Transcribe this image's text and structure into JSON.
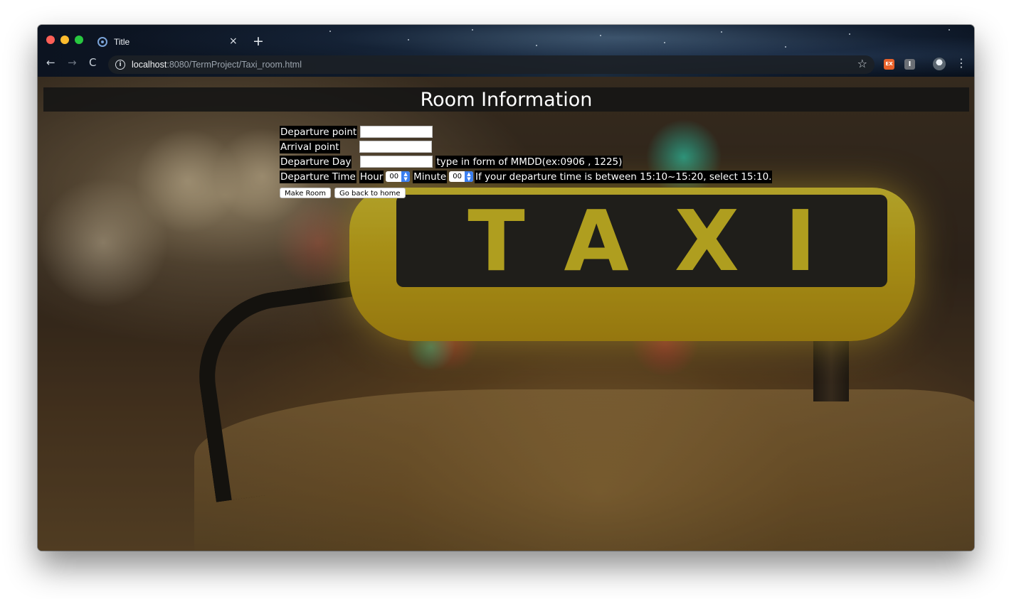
{
  "browser": {
    "tab_title": "Title",
    "url_host": "localhost",
    "url_path": ":8080/TermProject/Taxi_room.html",
    "close_glyph": "×",
    "new_tab_glyph": "+",
    "back_glyph": "←",
    "forward_glyph": "→",
    "reload_glyph": "C",
    "info_glyph": "i",
    "star_glyph": "☆",
    "menu_glyph": "⋮",
    "ext_ex_label": "EX",
    "ext_bookmark_label": "I"
  },
  "page": {
    "header_title": "Room Information",
    "taxi_sign_text": "TAXI",
    "form": {
      "departure_point_label": "Departure point",
      "departure_point_value": "",
      "arrival_point_label": "Arrival point",
      "arrival_point_value": "",
      "departure_day_label": "Departure Day",
      "departure_day_value": "",
      "departure_day_hint": "type in form of MMDD(ex:0906 , 1225)",
      "departure_time_label": "Departure Time",
      "hour_label": "Hour",
      "hour_value": "00",
      "minute_label": "Minute",
      "minute_value": "00",
      "time_hint": "If your departure time is between 15:10~15:20, select 15:10."
    },
    "buttons": {
      "make_room": "Make Room",
      "go_home": "Go back to home"
    }
  },
  "colors": {
    "header_bg": "#141414",
    "select_accent": "#3b7ff0",
    "taxi_yellow": "#f3dc2c"
  }
}
